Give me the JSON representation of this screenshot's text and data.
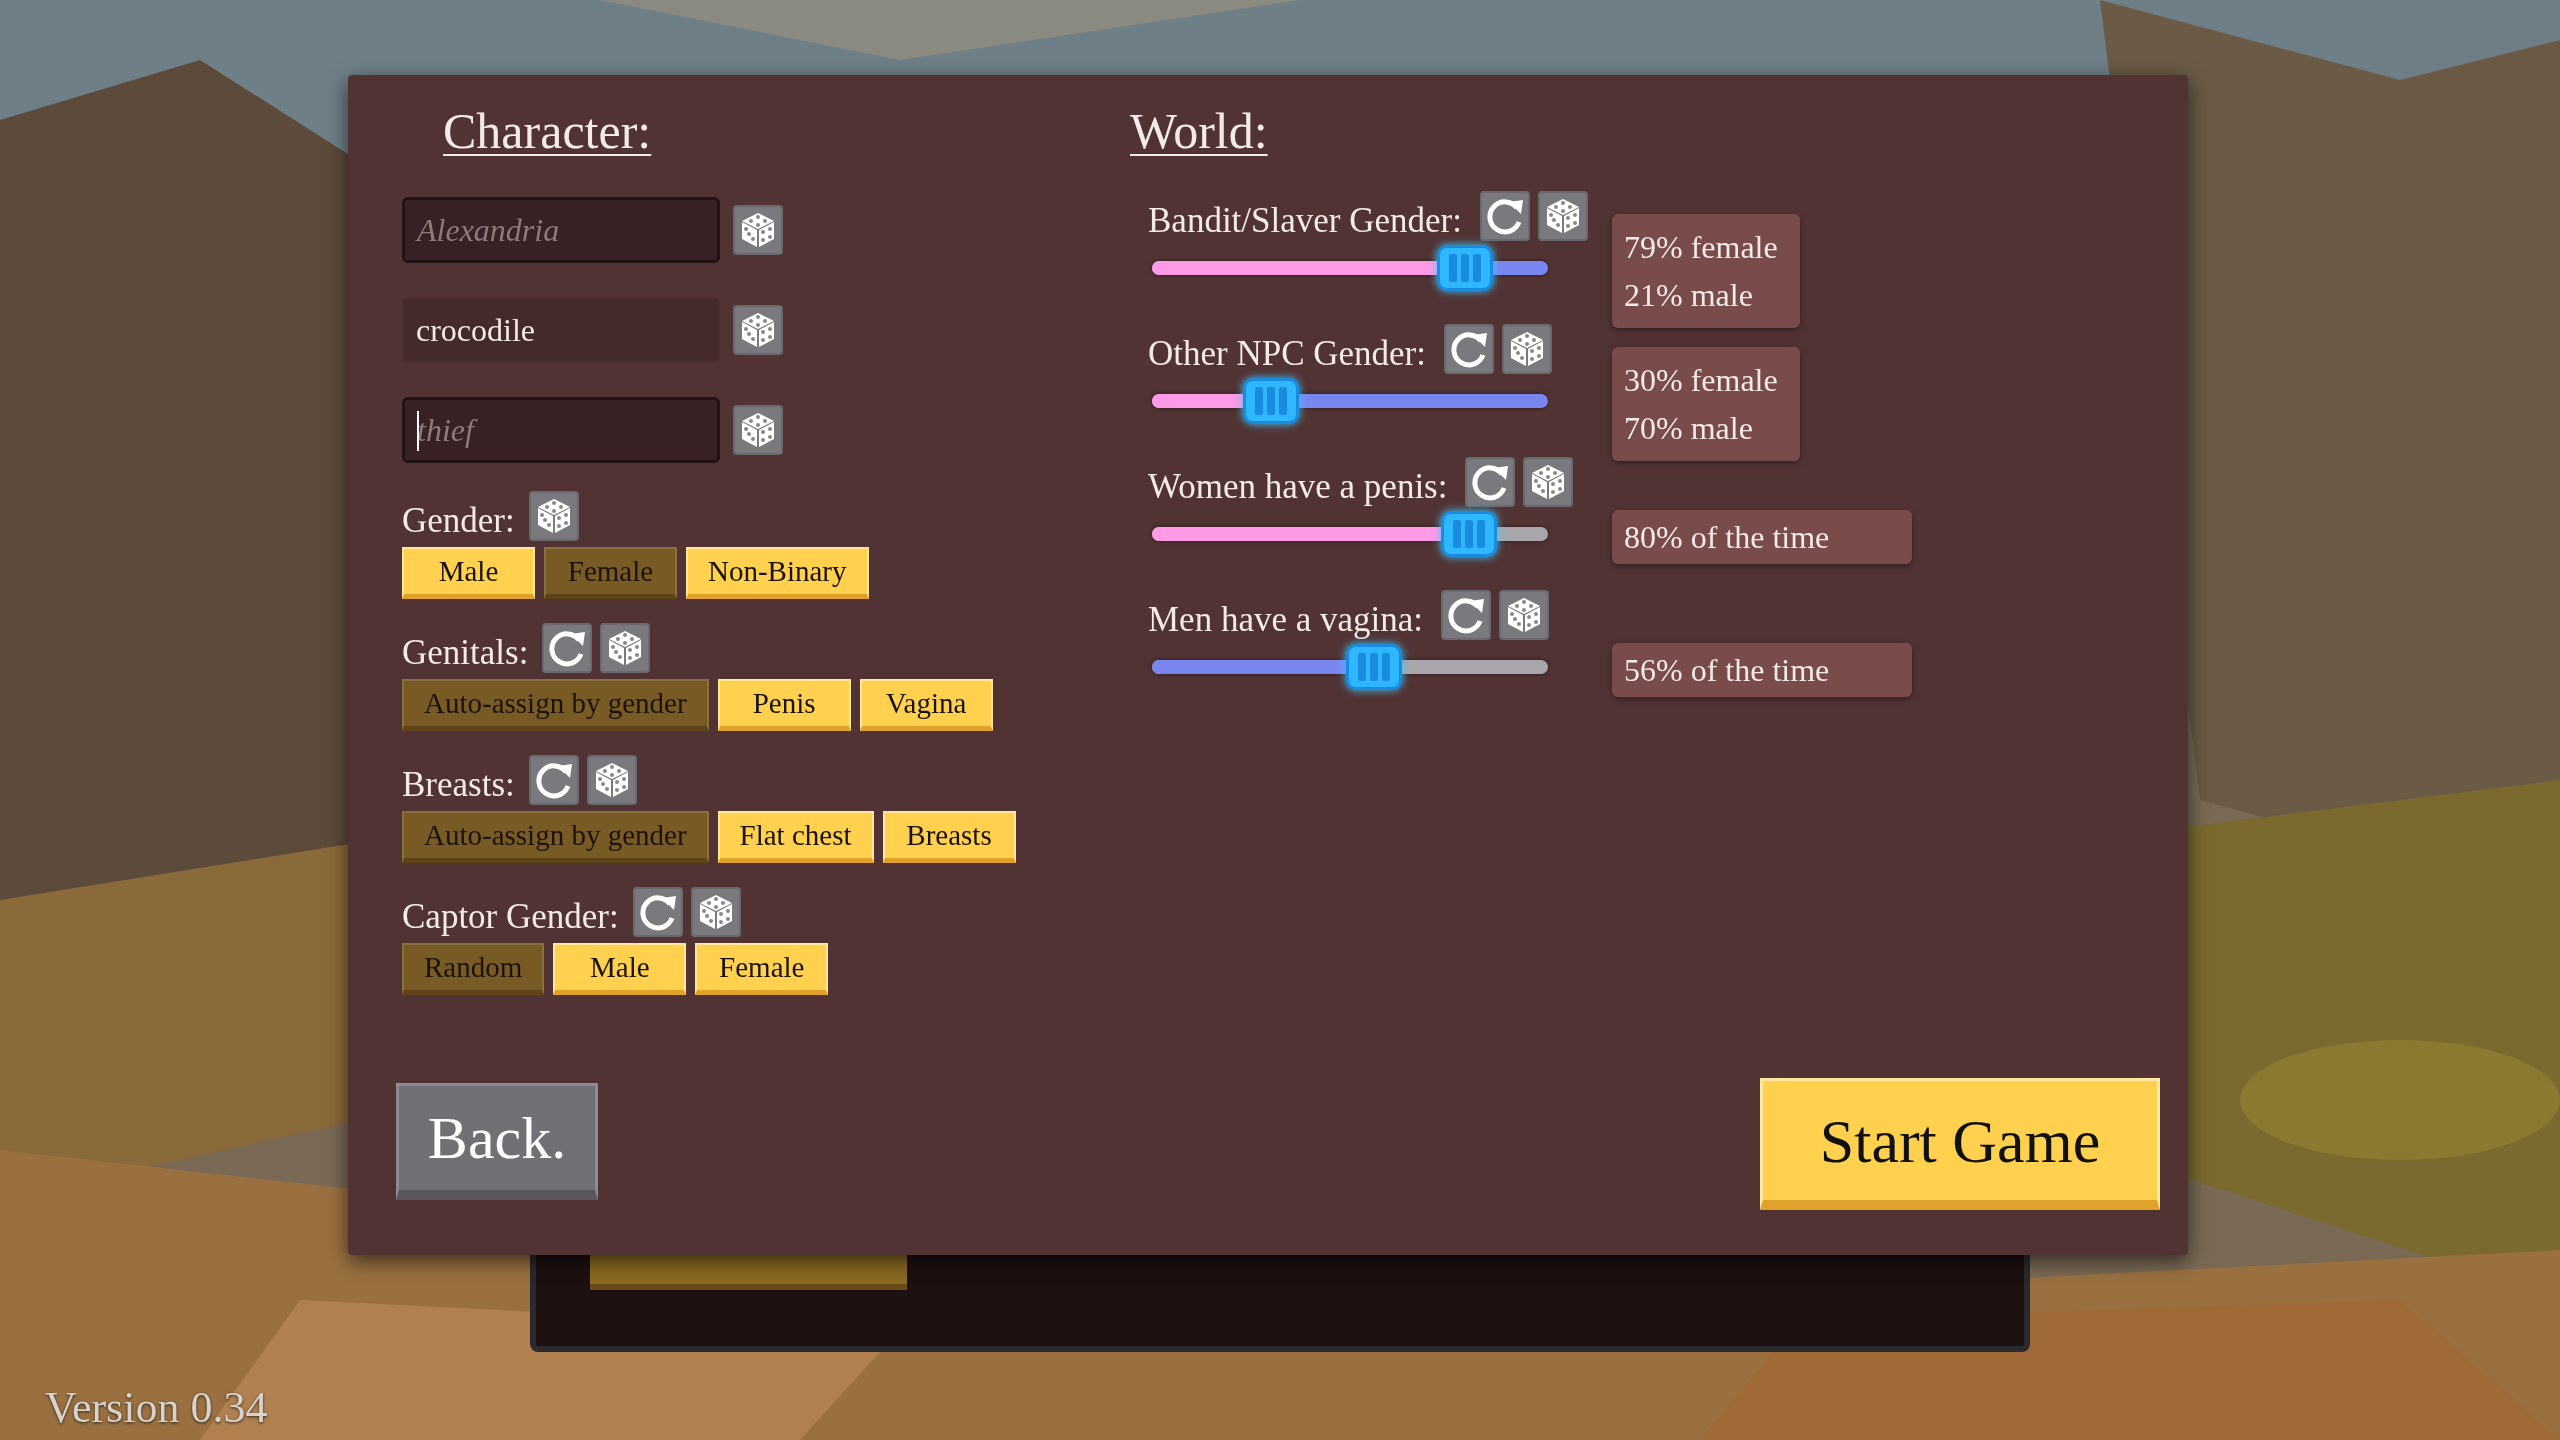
{
  "character": {
    "heading": "Character:",
    "fields": [
      {
        "placeholder": "Alexandria",
        "focused": false
      },
      {
        "value": "crocodile",
        "focused": false
      },
      {
        "placeholder": "thief",
        "focused": true
      }
    ],
    "groups": [
      {
        "label": "Gender:",
        "reset": false,
        "options": [
          {
            "label": "Male",
            "selected": false
          },
          {
            "label": "Female",
            "selected": true
          },
          {
            "label": "Non-Binary",
            "selected": false
          }
        ]
      },
      {
        "label": "Genitals:",
        "reset": true,
        "options": [
          {
            "label": "Auto-assign by gender",
            "selected": true
          },
          {
            "label": "Penis",
            "selected": false
          },
          {
            "label": "Vagina",
            "selected": false
          }
        ]
      },
      {
        "label": "Breasts:",
        "reset": true,
        "options": [
          {
            "label": "Auto-assign by gender",
            "selected": true
          },
          {
            "label": "Flat chest",
            "selected": false
          },
          {
            "label": "Breasts",
            "selected": false
          }
        ]
      },
      {
        "label": "Captor Gender:",
        "reset": true,
        "options": [
          {
            "label": "Random",
            "selected": true
          },
          {
            "label": "Male",
            "selected": false
          },
          {
            "label": "Female",
            "selected": false
          }
        ]
      }
    ]
  },
  "world": {
    "heading": "World:",
    "sliders": [
      {
        "label": "Bandit/Slaver Gender:",
        "kind": "gender",
        "level": 0.79,
        "readout": [
          "79% female",
          "21% male"
        ]
      },
      {
        "label": "Other NPC Gender:",
        "kind": "gender",
        "level": 0.3,
        "readout": [
          "30% female",
          "70% male"
        ]
      },
      {
        "label": "Women have a penis:",
        "kind": "female_chance",
        "level": 0.8,
        "readout": [
          "80% of the time"
        ]
      },
      {
        "label": "Men have a vagina:",
        "kind": "male_chance",
        "level": 0.56,
        "readout": [
          "56% of the time"
        ]
      }
    ]
  },
  "buttons": {
    "back": "Back.",
    "start": "Start Game"
  },
  "version": "Version 0.34"
}
